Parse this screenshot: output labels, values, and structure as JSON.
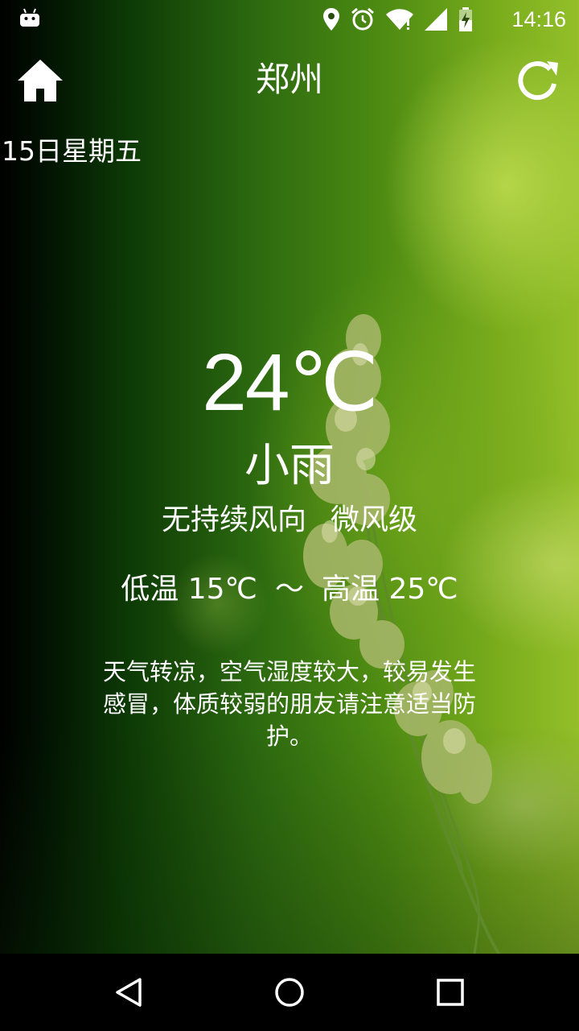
{
  "status_bar": {
    "time": "14:16",
    "icons": [
      "android-icon",
      "location-icon",
      "alarm-icon",
      "wifi-icon",
      "signal-icon",
      "battery-charging-icon"
    ]
  },
  "toolbar": {
    "city": "郑州",
    "home_icon": "home-icon",
    "refresh_icon": "refresh-icon"
  },
  "date": "15日星期五",
  "weather": {
    "temperature": "24℃",
    "condition": "小雨",
    "wind_direction": "无持续风向",
    "wind_level": "微风级",
    "low": "低温 15℃",
    "separator": "～",
    "high": "高温 25℃",
    "tip": "天气转凉，空气湿度较大，较易发生感冒，体质较弱的朋友请注意适当防护。"
  },
  "nav_bar": {
    "icons": [
      "back-icon",
      "home-circle-icon",
      "recents-icon"
    ]
  }
}
